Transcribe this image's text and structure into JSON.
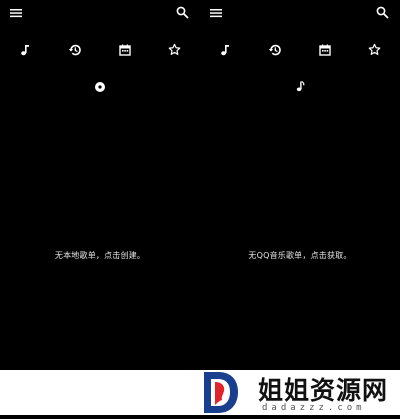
{
  "left_panel": {
    "empty_message": "无本地歌单，点击创建。"
  },
  "right_panel": {
    "empty_message": "无QQ音乐歌单，点击获取。"
  },
  "icons": {
    "menu": "menu-icon",
    "search": "search-icon",
    "music": "music-note-icon",
    "history": "history-icon",
    "calendar": "calendar-icon",
    "favorite": "star-icon",
    "disc": "disc-icon"
  },
  "watermark": {
    "title": "姐姐资源网",
    "url": "dadazzz.com",
    "brand_blue": "#1a3f8f",
    "brand_red": "#e0242a"
  },
  "colors": {
    "background": "#000000",
    "foreground": "#ffffff"
  }
}
